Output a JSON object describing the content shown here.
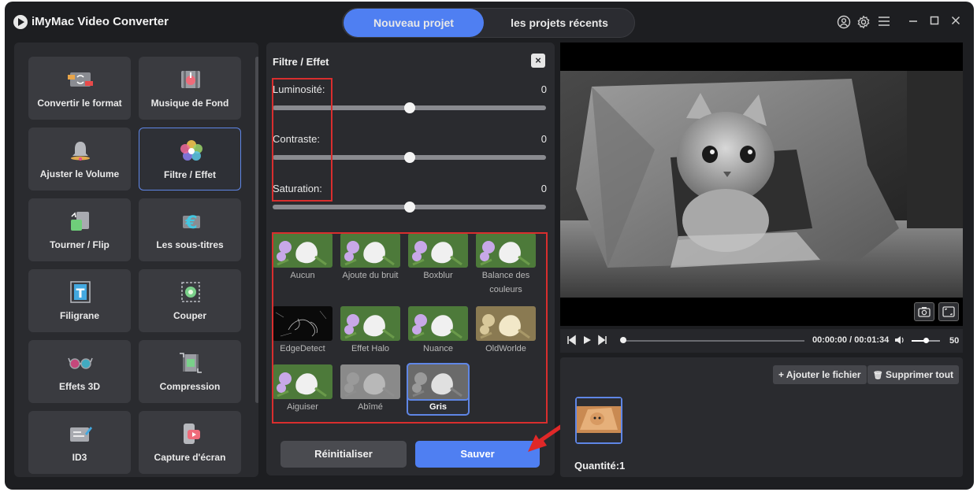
{
  "app": {
    "title": "iMyMac Video Converter"
  },
  "header": {
    "tabs": [
      {
        "label": "Nouveau projet",
        "active": true
      },
      {
        "label": "les projets récents",
        "active": false
      }
    ],
    "icons": [
      "user-icon",
      "gear-icon",
      "menu-icon",
      "minimize-icon",
      "maximize-icon",
      "close-icon"
    ]
  },
  "sidebar": {
    "tools": [
      {
        "label": "Convertir le format",
        "icon": "convert-format-icon"
      },
      {
        "label": "Musique de Fond",
        "icon": "background-music-icon"
      },
      {
        "label": "Ajuster le Volume",
        "icon": "volume-bell-icon"
      },
      {
        "label": "Filtre / Effet",
        "icon": "filter-effect-icon",
        "active": true
      },
      {
        "label": "Tourner / Flip",
        "icon": "rotate-flip-icon"
      },
      {
        "label": "Les sous-titres",
        "icon": "subtitles-icon"
      },
      {
        "label": "Filigrane",
        "icon": "watermark-icon"
      },
      {
        "label": "Couper",
        "icon": "crop-icon"
      },
      {
        "label": "Effets 3D",
        "icon": "3d-glasses-icon"
      },
      {
        "label": "Compression",
        "icon": "compression-icon"
      },
      {
        "label": "ID3",
        "icon": "id3-tag-icon"
      },
      {
        "label": "Capture d'écran",
        "icon": "screen-capture-icon"
      }
    ]
  },
  "filter_panel": {
    "title": "Filtre / Effet",
    "sliders": [
      {
        "label": "Luminosité:",
        "value": "0",
        "level": 0.5
      },
      {
        "label": "Contraste:",
        "value": "0",
        "level": 0.5
      },
      {
        "label": "Saturation:",
        "value": "0",
        "level": 0.5
      }
    ],
    "filters": [
      {
        "label": "Aucun",
        "style": "normal"
      },
      {
        "label": "Ajoute du bruit",
        "style": "normal"
      },
      {
        "label": "Boxblur",
        "style": "normal"
      },
      {
        "label": "Balance des couleurs",
        "style": "normal"
      },
      {
        "label": "EdgeDetect",
        "style": "edge"
      },
      {
        "label": "Effet Halo",
        "style": "normal"
      },
      {
        "label": "Nuance",
        "style": "normal"
      },
      {
        "label": "OldWorlde",
        "style": "sepia"
      },
      {
        "label": "Aiguiser",
        "style": "normal"
      },
      {
        "label": "Abîmé",
        "style": "emboss"
      },
      {
        "label": "Gris",
        "style": "gray",
        "active": true
      }
    ],
    "reset_label": "Réinitialiser",
    "save_label": "Sauver"
  },
  "player": {
    "time": "00:00:00 / 00:01:34",
    "volume": "50",
    "volume_level": 0.5,
    "progress": 0
  },
  "files": {
    "add_label": "+ Ajouter le fichier",
    "delete_label": "Supprimer tout",
    "quantity": "Quantité:1"
  }
}
